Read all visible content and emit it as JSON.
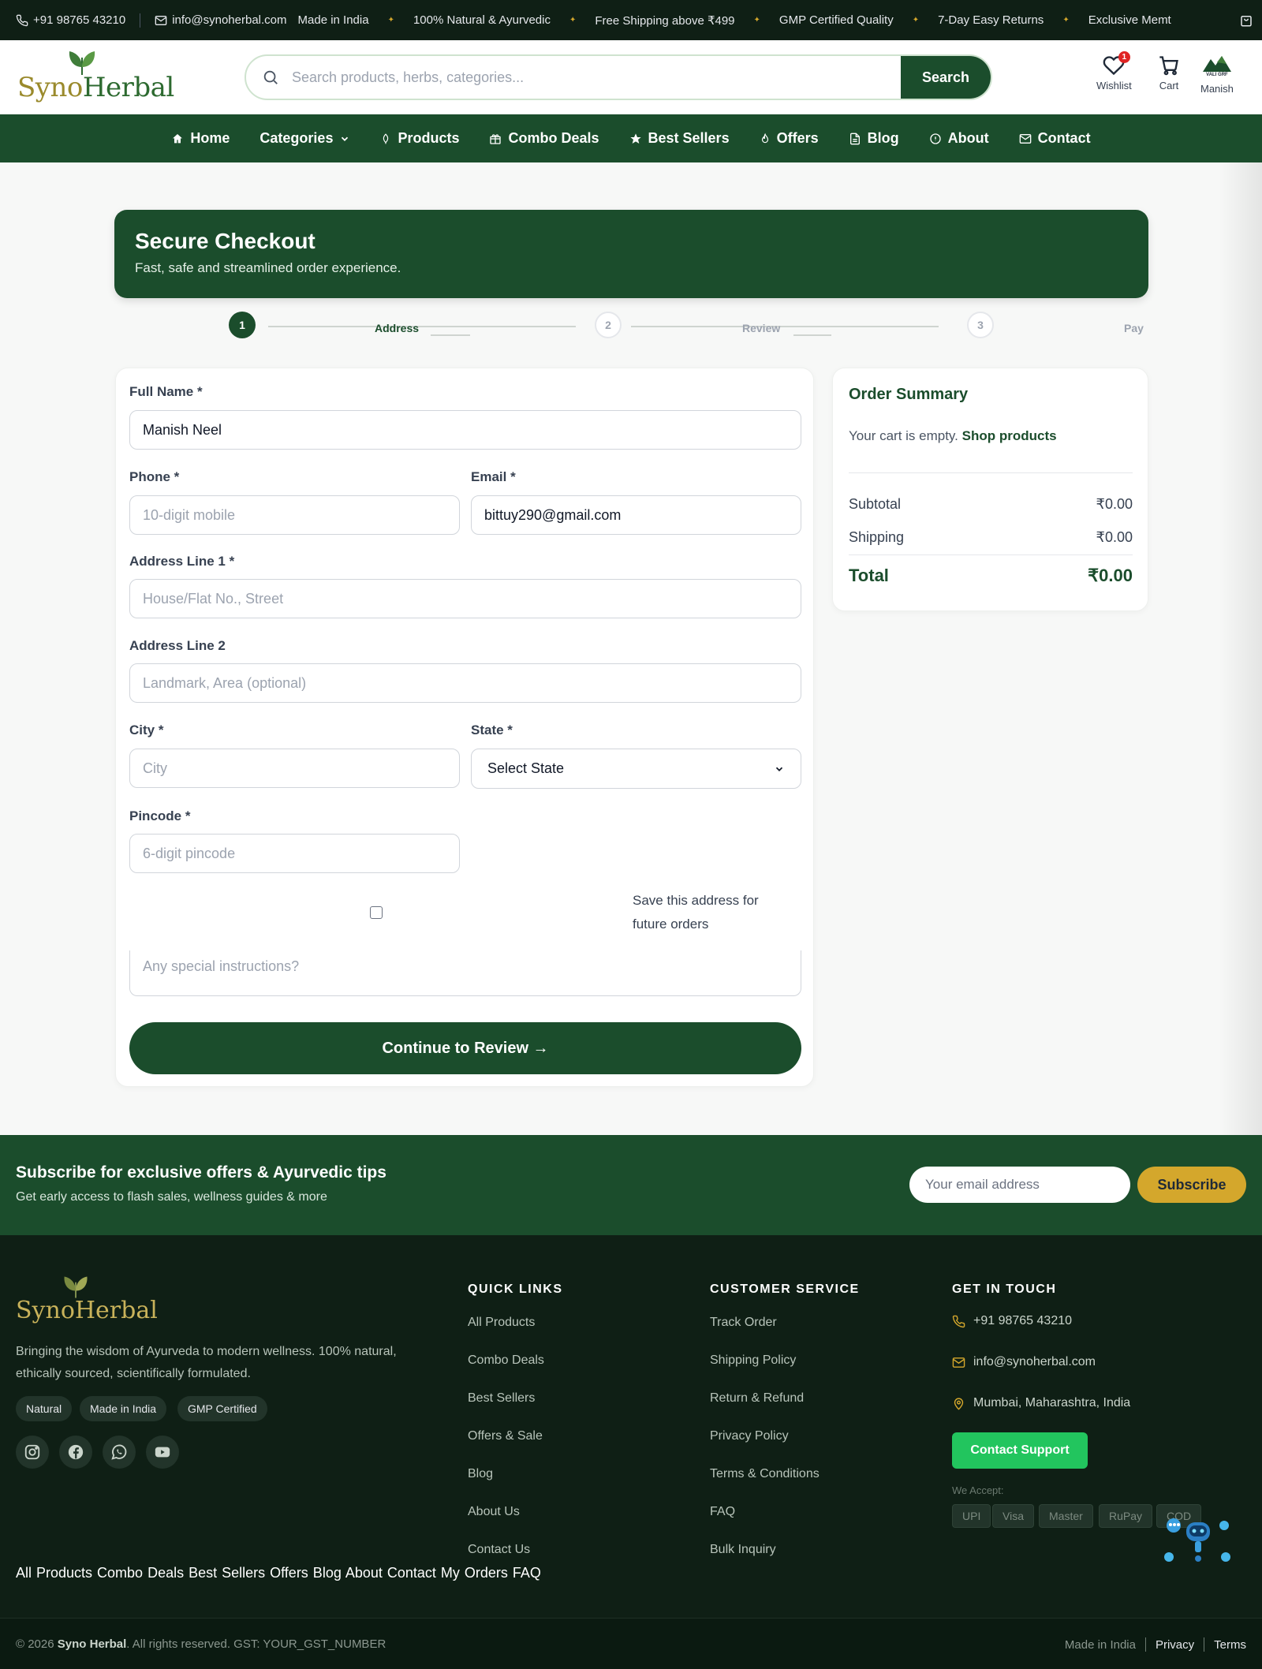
{
  "topbar": {
    "phone": "+91 98765 43210",
    "email": "info@synoherbal.com",
    "marquee": [
      "Made in India",
      "100% Natural & Ayurvedic",
      "Free Shipping above ₹499",
      "GMP Certified Quality",
      "7-Day Easy Returns",
      "Exclusive Memt"
    ]
  },
  "header": {
    "logo_prefix": "Syno",
    "logo_suffix": "Herbal",
    "search_placeholder": "Search products, herbs, categories...",
    "search_button": "Search",
    "wishlist_label": "Wishlist",
    "wishlist_count": "1",
    "cart_label": "Cart",
    "user_label": "Manish",
    "avatar_text": "VALI GRF"
  },
  "nav": {
    "items": [
      {
        "label": "Home",
        "icon": "home-icon"
      },
      {
        "label": "Categories",
        "icon": "chevron-down-icon"
      },
      {
        "label": "Products",
        "icon": "leaf-icon"
      },
      {
        "label": "Combo Deals",
        "icon": "gift-icon"
      },
      {
        "label": "Best Sellers",
        "icon": "star-icon"
      },
      {
        "label": "Offers",
        "icon": "flame-icon"
      },
      {
        "label": "Blog",
        "icon": "document-icon"
      },
      {
        "label": "About",
        "icon": "info-icon"
      },
      {
        "label": "Contact",
        "icon": "mail-icon"
      }
    ]
  },
  "hero": {
    "title": "Secure Checkout",
    "subtitle": "Fast, safe and streamlined order experience."
  },
  "steps": [
    {
      "number": "1",
      "label": "Address",
      "active": true
    },
    {
      "number": "2",
      "label": "Review",
      "active": false
    },
    {
      "number": "3",
      "label": "Pay",
      "active": false
    }
  ],
  "form": {
    "full_name_label": "Full Name *",
    "full_name_value": "Manish Neel",
    "phone_label": "Phone *",
    "phone_placeholder": "10-digit mobile",
    "email_label": "Email *",
    "email_value": "bittuy290@gmail.com",
    "address1_label": "Address Line 1 *",
    "address1_placeholder": "House/Flat No., Street",
    "address2_label": "Address Line 2",
    "address2_placeholder": "Landmark, Area (optional)",
    "city_label": "City *",
    "city_placeholder": "City",
    "state_label": "State *",
    "state_selected": "Select State",
    "pincode_label": "Pincode *",
    "pincode_placeholder": "6-digit pincode",
    "save_address_label": "Save this address for future orders",
    "instructions_placeholder": "Any special instructions?",
    "continue_button": "Continue to Review →"
  },
  "summary": {
    "title": "Order Summary",
    "empty_text": "Your cart is empty.",
    "shop_link": "Shop products",
    "subtotal_label": "Subtotal",
    "subtotal_value": "₹0.00",
    "shipping_label": "Shipping",
    "shipping_value": "₹0.00",
    "total_label": "Total",
    "total_value": "₹0.00"
  },
  "subscribe": {
    "title": "Subscribe for exclusive offers & Ayurvedic tips",
    "subtitle": "Get early access to flash sales, wellness guides & more",
    "placeholder": "Your email address",
    "button": "Subscribe"
  },
  "footer": {
    "logo": "SynoHerbal",
    "description": "Bringing the wisdom of Ayurveda to modern wellness. 100% natural, ethically sourced, scientifically formulated.",
    "chips": [
      "Natural",
      "Made in India",
      "GMP Certified"
    ],
    "social": [
      "instagram-icon",
      "facebook-icon",
      "whatsapp-icon",
      "youtube-icon"
    ],
    "quick_links_title": "QUICK LINKS",
    "quick_links": [
      "All Products",
      "Combo Deals",
      "Best Sellers",
      "Offers & Sale",
      "Blog",
      "About Us",
      "Contact Us"
    ],
    "customer_service_title": "CUSTOMER SERVICE",
    "customer_service": [
      "Track Order",
      "Shipping Policy",
      "Return & Refund",
      "Privacy Policy",
      "Terms & Conditions",
      "FAQ",
      "Bulk Inquiry"
    ],
    "get_in_touch_title": "GET IN TOUCH",
    "phone": "+91 98765 43210",
    "email": "info@synoherbal.com",
    "location": "Mumbai, Maharashtra, India",
    "contact_button": "Contact Support",
    "we_accept": "We Accept:",
    "payments": [
      "UPI",
      "Visa",
      "Master",
      "RuPay",
      "COD"
    ],
    "inline_links": "All Products Combo Deals Best Sellers Offers Blog About Contact My Orders FAQ",
    "copyright_prefix": "© 2026",
    "copyright_brand": "Syno Herbal",
    "copyright_suffix": ". All rights reserved. GST: YOUR_GST_NUMBER",
    "made_in": "Made in India",
    "privacy": "Privacy",
    "terms": "Terms"
  },
  "colors": {
    "primary": "#1b4d2c",
    "accent_gold": "#d4a72c",
    "footer_bg": "#0f1f15",
    "success": "#22c55e",
    "badge": "#e02424"
  }
}
